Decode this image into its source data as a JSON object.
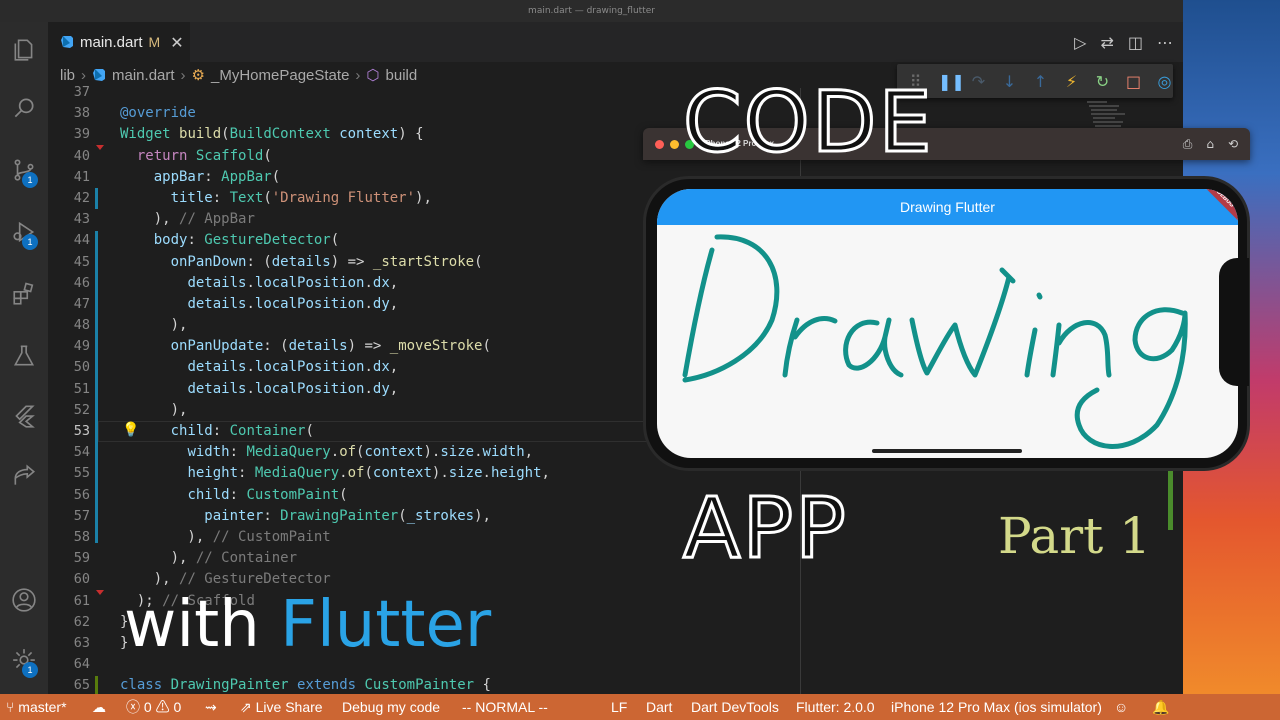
{
  "window": {
    "title": "main.dart — drawing_flutter"
  },
  "tab": {
    "filename": "main.dart",
    "modified_marker": "M",
    "close": "✕"
  },
  "breadcrumb": {
    "parts": [
      "lib",
      "main.dart",
      "_MyHomePageState",
      "build"
    ]
  },
  "activity_badges": {
    "source_control": "1",
    "run_debug": "1",
    "manage": "1"
  },
  "editor": {
    "line_numbers": [
      "37",
      "38",
      "39",
      "40",
      "41",
      "42",
      "43",
      "44",
      "45",
      "46",
      "47",
      "48",
      "49",
      "50",
      "51",
      "52",
      "53",
      "54",
      "55",
      "56",
      "57",
      "58",
      "59",
      "60",
      "61",
      "62",
      "63",
      "64",
      "65"
    ],
    "active_line": "53"
  },
  "simulator": {
    "title": "iPhone 12 Pro Max",
    "appbar_title": "Drawing Flutter",
    "debug_banner": "DEBUG"
  },
  "overlay": {
    "code": "CODE",
    "app": "APP",
    "part": "Part 1",
    "with": "with",
    "flutter": "Flutter"
  },
  "statusbar": {
    "branch": "master*",
    "errors": "0",
    "warnings": "0",
    "live_share": "Live Share",
    "debug_my_code": "Debug my code",
    "mode": "-- NORMAL --",
    "eol": "LF",
    "language": "Dart",
    "devtools": "Dart DevTools",
    "flutter_version": "Flutter: 2.0.0",
    "device": "iPhone 12 Pro Max (ios simulator)"
  },
  "colors": {
    "statusbar": "#cc6633",
    "appbar": "#2196f3",
    "stroke": "#12918a",
    "with_flutter": "#2aa3e6",
    "part": "#d3d98a"
  }
}
